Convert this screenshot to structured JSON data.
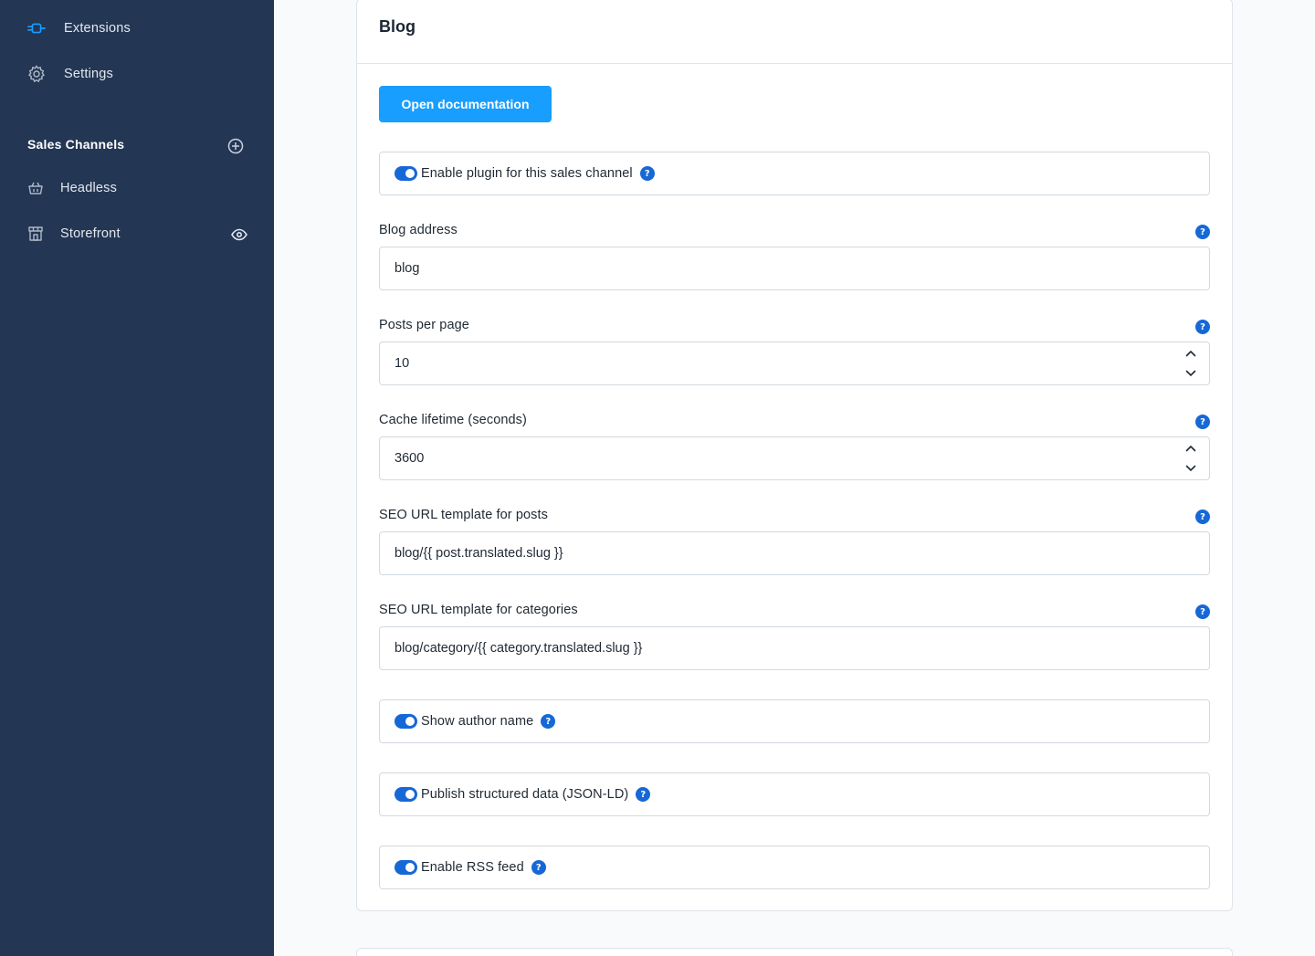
{
  "sidebar": {
    "nav": [
      {
        "label": "Extensions",
        "icon": "plug-icon"
      },
      {
        "label": "Settings",
        "icon": "gear-icon"
      }
    ],
    "sales_channels": {
      "heading": "Sales Channels",
      "items": [
        {
          "label": "Headless",
          "icon": "basket-icon"
        },
        {
          "label": "Storefront",
          "icon": "storefront-icon"
        }
      ]
    },
    "colors": {
      "background": "#233654",
      "accent": "#189eff"
    }
  },
  "card": {
    "title": "Blog",
    "doc_button": "Open documentation",
    "enable_plugin": {
      "label": "Enable plugin for this sales channel",
      "checked": true
    },
    "blog_address": {
      "label": "Blog address",
      "value": "blog"
    },
    "posts_per_page": {
      "label": "Posts per page",
      "value": "10"
    },
    "cache_lifetime": {
      "label": "Cache lifetime (seconds)",
      "value": "3600"
    },
    "seo_posts": {
      "label": "SEO URL template for posts",
      "value": "blog/{{ post.translated.slug }}"
    },
    "seo_categories": {
      "label": "SEO URL template for categories",
      "value": "blog/category/{{ category.translated.slug }}"
    },
    "show_author": {
      "label": "Show author name",
      "checked": true
    },
    "structured_data": {
      "label": "Publish structured data (JSON-LD)",
      "checked": true
    },
    "rss_feed": {
      "label": "Enable RSS feed",
      "checked": true
    },
    "help_glyph": "?"
  }
}
